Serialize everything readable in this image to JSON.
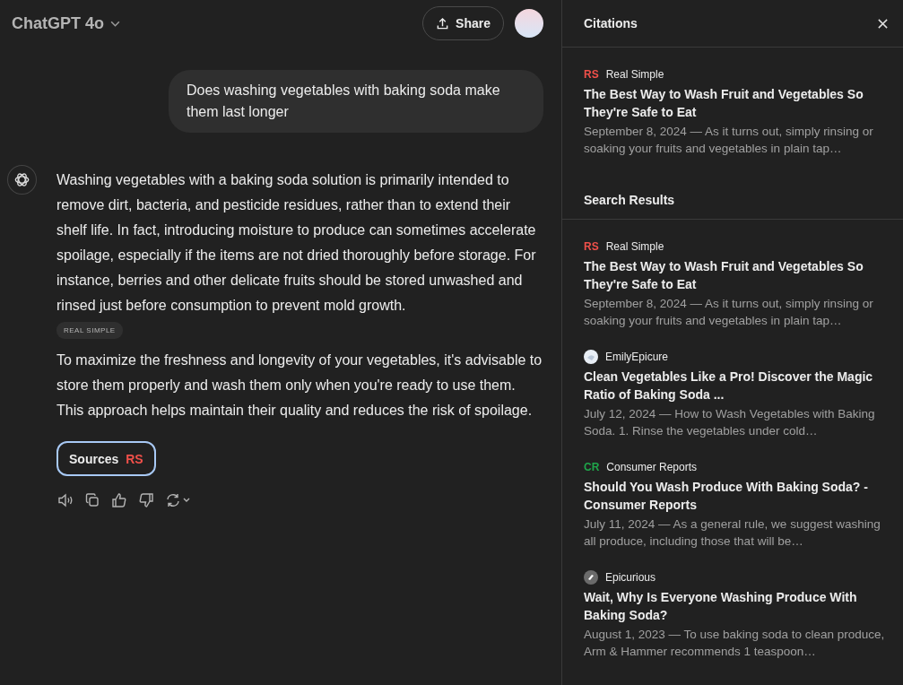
{
  "header": {
    "model": "ChatGPT 4o",
    "share": "Share"
  },
  "user_message": "Does washing vegetables with baking soda make them last longer",
  "assistant": {
    "paragraphs": [
      {
        "text": "Washing vegetables with a baking soda solution is primarily intended to remove dirt, bacteria, and pesticide residues, rather than to extend their shelf life. In fact, introducing moisture to produce can sometimes accelerate spoilage, especially if the items are not dried thoroughly before storage. For instance, berries and other delicate fruits should be stored unwashed and rinsed just before consumption to prevent mold growth.",
        "citation": "REAL SIMPLE"
      },
      {
        "text": "To maximize the freshness and longevity of your vegetables, it's advisable to store them properly and wash them only when you're ready to use them. This approach helps maintain their quality and reduces the risk of spoilage."
      }
    ],
    "sources_button": {
      "label": "Sources",
      "logos": [
        {
          "kind": "text",
          "text": "RS",
          "color": "#f0504a"
        }
      ]
    }
  },
  "panel": {
    "title": "Citations",
    "citations": [
      {
        "logo": {
          "kind": "text",
          "text": "RS",
          "color": "#f0504a"
        },
        "source": "Real Simple",
        "title": "The Best Way to Wash Fruit and Vegetables So They're Safe to Eat",
        "snippet": "September 8, 2024 — As it turns out, simply rinsing or soaking your fruits and vegetables in plain tap…"
      }
    ],
    "search_title": "Search Results",
    "results": [
      {
        "logo": {
          "kind": "text",
          "text": "RS",
          "color": "#f0504a"
        },
        "source": "Real Simple",
        "title": "The Best Way to Wash Fruit and Vegetables So They're Safe to Eat",
        "snippet": "September 8, 2024 — As it turns out, simply rinsing or soaking your fruits and vegetables in plain tap…"
      },
      {
        "logo": {
          "kind": "avatar"
        },
        "source": "EmilyEpicure",
        "title": "Clean Vegetables Like a Pro! Discover the Magic Ratio of Baking Soda ...",
        "snippet": "July 12, 2024 — How to Wash Vegetables with Baking Soda. 1. Rinse the vegetables under cold…"
      },
      {
        "logo": {
          "kind": "text",
          "text": "CR",
          "color": "#1fa64a"
        },
        "source": "Consumer Reports",
        "title": "Should You Wash Produce With Baking Soda? - Consumer Reports",
        "snippet": "July 11, 2024 — As a general rule, we suggest washing all produce, including those that will be…"
      },
      {
        "logo": {
          "kind": "glyph"
        },
        "source": "Epicurious",
        "title": "Wait, Why Is Everyone Washing Produce With Baking Soda?",
        "snippet": "August 1, 2023 — To use baking soda to clean produce, Arm & Hammer recommends 1 teaspoon…"
      }
    ]
  }
}
